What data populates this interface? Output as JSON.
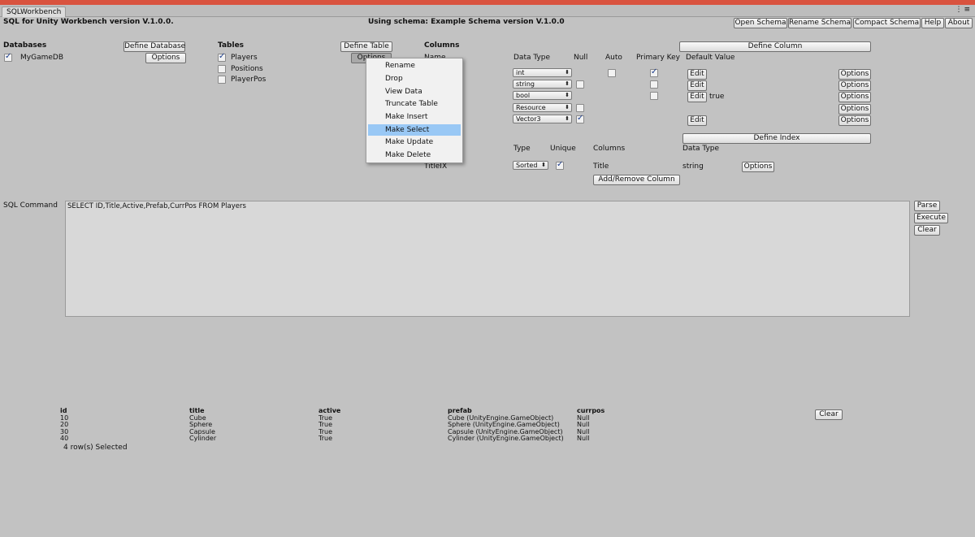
{
  "window": {
    "tab": "SQLWorkbench",
    "menu": "⋮≡"
  },
  "header": {
    "title": "SQL for Unity Workbench version V.1.0.0.",
    "schema": "Using schema: Example Schema version V.1.0.0",
    "buttons": [
      "Open Schema",
      "Rename Schema",
      "Compact Schema",
      "Help",
      "About"
    ]
  },
  "databases": {
    "label": "Databases",
    "define": "Define Database",
    "options": "Options",
    "items": [
      {
        "name": "MyGameDB",
        "checked": true
      }
    ]
  },
  "tables": {
    "label": "Tables",
    "define": "Define Table",
    "options": "Options",
    "items": [
      {
        "name": "Players",
        "checked": true
      },
      {
        "name": "Positions",
        "checked": false
      },
      {
        "name": "PlayerPos",
        "checked": false
      }
    ]
  },
  "context_menu": {
    "items": [
      "Rename",
      "Drop",
      "View Data",
      "Truncate Table",
      "Make Insert",
      "Make Select",
      "Make Update",
      "Make Delete"
    ],
    "selected": "Make Select"
  },
  "columns": {
    "label": "Columns",
    "name_header": "Name",
    "define": "Define Column",
    "headers": {
      "type": "Data Type",
      "null": "Null",
      "auto": "Auto",
      "pk": "Primary Key",
      "default": "Default Value"
    },
    "rows": [
      {
        "type": "int",
        "null": null,
        "auto": false,
        "pk": true,
        "edit": true,
        "default": ""
      },
      {
        "type": "string",
        "null": false,
        "auto": null,
        "pk": false,
        "edit": true,
        "default": ""
      },
      {
        "type": "bool",
        "null": null,
        "auto": null,
        "pk": false,
        "edit": true,
        "default": "true"
      },
      {
        "type": "Resource",
        "null": false,
        "auto": null,
        "pk": null,
        "edit": false,
        "default": ""
      },
      {
        "type": "Vector3",
        "null": true,
        "auto": null,
        "pk": null,
        "edit": true,
        "default": ""
      }
    ],
    "edit_label": "Edit",
    "options_label": "Options"
  },
  "index": {
    "define": "Define Index",
    "headers": {
      "type": "Type",
      "unique": "Unique",
      "columns": "Columns",
      "dtype": "Data Type"
    },
    "row": {
      "name": "TitleIX",
      "type": "Sorted",
      "unique": true,
      "column": "Title",
      "dtype": "string"
    },
    "options": "Options",
    "add_remove": "Add/Remove Column"
  },
  "sql": {
    "label": "SQL Command",
    "text": "SELECT ID,Title,Active,Prefab,CurrPos FROM Players",
    "buttons": [
      "Parse",
      "Execute",
      "Clear"
    ]
  },
  "results": {
    "headers": [
      "id",
      "title",
      "active",
      "prefab",
      "currpos"
    ],
    "rows": [
      [
        "10",
        "Cube",
        "True",
        "Cube (UnityEngine.GameObject)",
        "Null"
      ],
      [
        "20",
        "Sphere",
        "True",
        "Sphere (UnityEngine.GameObject)",
        "Null"
      ],
      [
        "30",
        "Capsule",
        "True",
        "Capsule (UnityEngine.GameObject)",
        "Null"
      ],
      [
        "40",
        "Cylinder",
        "True",
        "Cylinder (UnityEngine.GameObject)",
        "Null"
      ]
    ],
    "status": "4 row(s) Selected",
    "clear": "Clear"
  }
}
